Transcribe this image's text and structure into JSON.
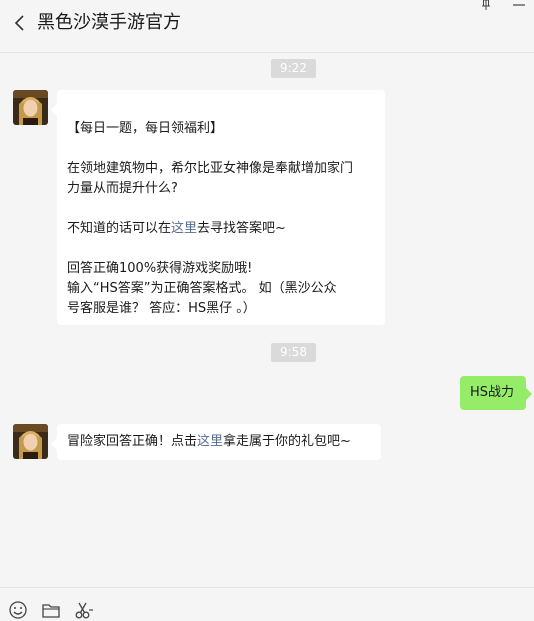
{
  "header": {
    "title": "黑色沙漠手游官方",
    "icons": [
      "back-icon",
      "pin-icon",
      "minimize-icon"
    ]
  },
  "messages": {
    "time1": "9:22",
    "msg1": {
      "line1": "【每日一题，每日领福利】",
      "line2": "在领地建筑物中，希尔比亚女神像是奉献增加家门",
      "line3": "力量从而提升什么?",
      "line4_pre": "不知道的话可以在",
      "line4_link": "这里",
      "line4_post": "去寻找答案吧~",
      "line5": "回答正确100%获得游戏奖励哦!",
      "line6": "输入“HS答案”为正确答案格式。 如（黑沙公众",
      "line7": "号客服是谁？ 答应：HS黑仔 。）"
    },
    "time2": "9:58",
    "reply": "HS战力",
    "msg2": {
      "pre": "冒险家回答正确！点击",
      "link": "这里",
      "post": "拿走属于你的礼包吧~"
    }
  },
  "footer": {
    "icons": [
      "emoji-icon",
      "folder-icon",
      "scissors-icon"
    ]
  },
  "colors": {
    "background": "#f5f5f5",
    "bubble_self": "#95ec69",
    "link": "#576b95",
    "time_badge": "#dadada"
  }
}
